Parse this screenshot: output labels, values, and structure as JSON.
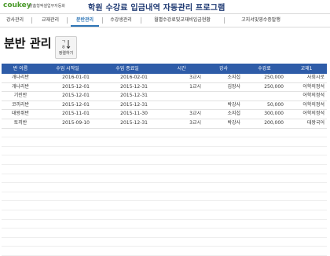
{
  "header": {
    "logo": "coukey",
    "logo_sub": "맞춤형엑셀업무자동화",
    "title": "학원 수강료 입금내역 자동관리 프로그램"
  },
  "nav": {
    "items": [
      {
        "label": "강사관리"
      },
      {
        "label": "교재관리"
      },
      {
        "label": "분반관리"
      },
      {
        "label": "수강생관리"
      },
      {
        "label": "월별수강료및교재비입금현황"
      },
      {
        "label": "고지서및영수증발행"
      }
    ]
  },
  "page": {
    "title": "분반 관리",
    "sort_button_label": "정렬하기"
  },
  "table": {
    "columns": [
      "반 이름",
      "수업 시작일",
      "수업 종료일",
      "시간",
      "강사",
      "수강료",
      "교재1"
    ],
    "rows": [
      [
        "개나리반",
        "2016-01-01",
        "2016-02-01",
        "3교시",
        "소지섭",
        "250,000",
        "사회시로"
      ],
      [
        "개나리반",
        "2015-12-01",
        "2015-12-31",
        "1교시",
        "김장사",
        "250,000",
        "어학의정석"
      ],
      [
        "기린반",
        "2015-12-01",
        "2015-12-31",
        "",
        "",
        "",
        "어학의정석"
      ],
      [
        "코끼리반",
        "2015-12-01",
        "2015-12-31",
        "",
        "박강사",
        "50,000",
        "어학의정석"
      ],
      [
        "대왕쥐반",
        "2015-11-01",
        "2015-11-30",
        "3교시",
        "소지섭",
        "300,000",
        "어학의정석"
      ],
      [
        "토끼반",
        "2015-09-10",
        "2015-12-31",
        "3교시",
        "박강사",
        "200,000",
        "대왕국어"
      ]
    ]
  },
  "colors": {
    "header_bg": "#2e5ca8",
    "active_tab": "#2e75b6",
    "logo": "#4a9a2a"
  }
}
